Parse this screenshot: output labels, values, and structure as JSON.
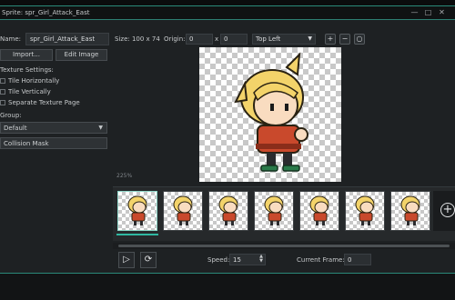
{
  "window": {
    "title": "Sprite: spr_Girl_Attack_East"
  },
  "properties": {
    "name_label": "Name:",
    "name_value": "spr_Girl_Attack_East",
    "import_button": "Import...",
    "edit_button": "Edit Image",
    "texture_settings_label": "Texture Settings:",
    "tile_h_label": "Tile Horizontally",
    "tile_v_label": "Tile Vertically",
    "separate_page_label": "Separate Texture Page",
    "group_label": "Group:",
    "group_value": "Default",
    "collision_mask_button": "Collision Mask"
  },
  "toolbar": {
    "size_label": "Size: 100 x 74",
    "origin_label": "Origin:",
    "origin_x": "0",
    "origin_sep": "x",
    "origin_y": "0",
    "origin_preset": "Top Left",
    "zoom_icons": [
      "zoom-in-icon",
      "zoom-out-icon",
      "zoom-reset-icon"
    ]
  },
  "canvas": {
    "zoom_percent": "225%"
  },
  "frames": {
    "count": 7,
    "selected_index": 0
  },
  "playback": {
    "speed_label": "Speed:",
    "speed_value": "15",
    "current_frame_label": "Current Frame:",
    "current_frame_value": "0"
  },
  "colors": {
    "accent": "#2fb8a1",
    "panel": "#1e2123"
  }
}
